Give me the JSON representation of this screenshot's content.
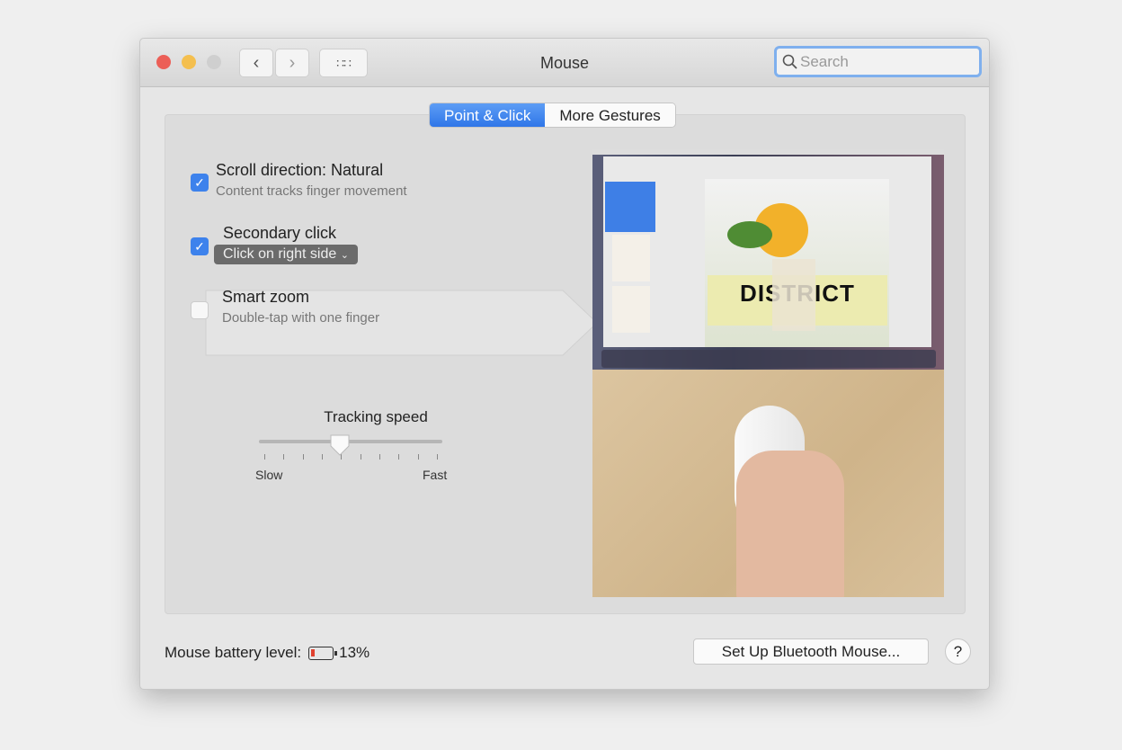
{
  "window": {
    "title": "Mouse",
    "search_placeholder": "Search"
  },
  "tabs": [
    {
      "label": "Point & Click",
      "active": true
    },
    {
      "label": "More Gestures",
      "active": false
    }
  ],
  "options": [
    {
      "label": "Scroll direction: Natural",
      "sublabel": "Content tracks finger movement",
      "checked": true
    },
    {
      "label": "Secondary click",
      "popup_value": "Click on right side",
      "checked": true
    },
    {
      "label": "Smart zoom",
      "sublabel": "Double-tap with one finger",
      "checked": false
    }
  ],
  "tracking": {
    "label": "Tracking speed",
    "min_label": "Slow",
    "max_label": "Fast",
    "value_fraction": 0.44,
    "ticks": 10
  },
  "preview": {
    "image_lettering": "DISTRICT"
  },
  "footer": {
    "battery_label": "Mouse battery level:",
    "battery_percent": "13%",
    "battery_level": 0.13,
    "setup_button": "Set Up Bluetooth Mouse...",
    "help": "?"
  },
  "colors": {
    "accent": "#3d82ec",
    "close": "#ec5f57",
    "minimize": "#f4bf4f",
    "battery_low": "#e0412f"
  }
}
